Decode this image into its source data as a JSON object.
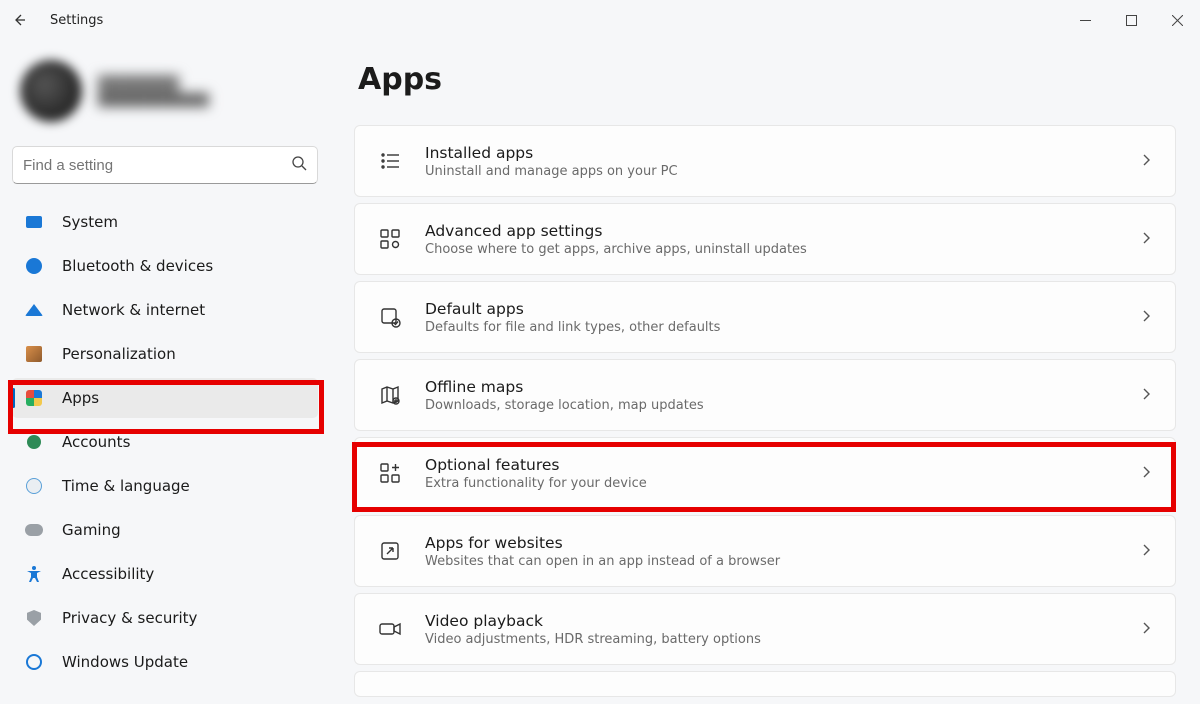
{
  "window": {
    "title": "Settings"
  },
  "account": {
    "name": "███████",
    "email": "████████████"
  },
  "search": {
    "placeholder": "Find a setting"
  },
  "sidebar": {
    "items": [
      {
        "label": "System"
      },
      {
        "label": "Bluetooth & devices"
      },
      {
        "label": "Network & internet"
      },
      {
        "label": "Personalization"
      },
      {
        "label": "Apps"
      },
      {
        "label": "Accounts"
      },
      {
        "label": "Time & language"
      },
      {
        "label": "Gaming"
      },
      {
        "label": "Accessibility"
      },
      {
        "label": "Privacy & security"
      },
      {
        "label": "Windows Update"
      }
    ],
    "selected_index": 4
  },
  "page": {
    "title": "Apps",
    "cards": [
      {
        "title": "Installed apps",
        "sub": "Uninstall and manage apps on your PC"
      },
      {
        "title": "Advanced app settings",
        "sub": "Choose where to get apps, archive apps, uninstall updates"
      },
      {
        "title": "Default apps",
        "sub": "Defaults for file and link types, other defaults"
      },
      {
        "title": "Offline maps",
        "sub": "Downloads, storage location, map updates"
      },
      {
        "title": "Optional features",
        "sub": "Extra functionality for your device"
      },
      {
        "title": "Apps for websites",
        "sub": "Websites that can open in an app instead of a browser"
      },
      {
        "title": "Video playback",
        "sub": "Video adjustments, HDR streaming, battery options"
      }
    ]
  },
  "highlights": {
    "sidebar_item_index": 4,
    "card_index": 4
  }
}
